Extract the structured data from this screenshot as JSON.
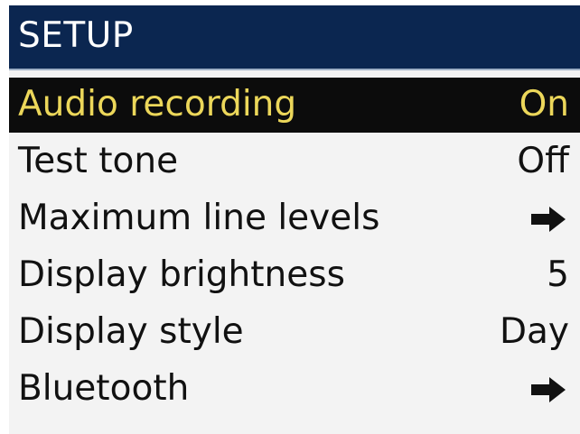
{
  "header": {
    "title": "SETUP"
  },
  "menu": {
    "items": [
      {
        "label": "Audio recording",
        "value": "On",
        "selected": true
      },
      {
        "label": "Test tone",
        "value": "Off"
      },
      {
        "label": "Maximum line levels",
        "icon": "arrow-right-icon"
      },
      {
        "label": "Display brightness",
        "value": "5"
      },
      {
        "label": "Display style",
        "value": "Day"
      },
      {
        "label": "Bluetooth",
        "icon": "arrow-right-icon"
      }
    ]
  },
  "colors": {
    "header_bg": "#0b2650",
    "screen_bg": "#f3f3f3",
    "selected_bg": "#0c0c0c",
    "selected_text": "#ecd75a",
    "text": "#111111"
  }
}
